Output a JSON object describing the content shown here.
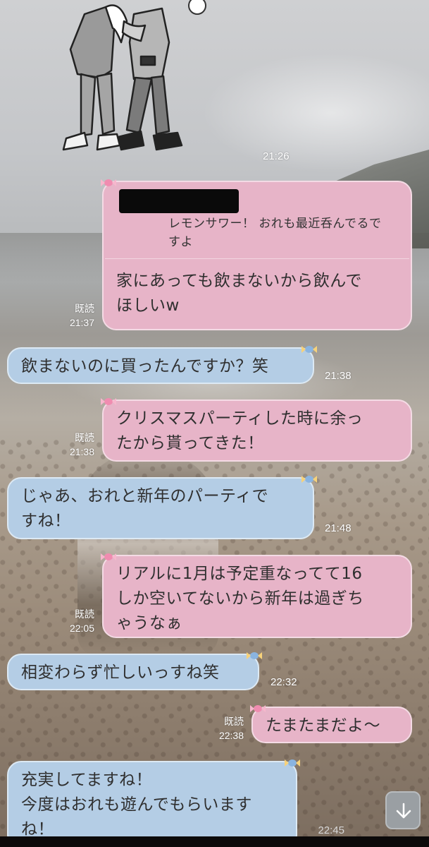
{
  "messages": [
    {
      "side": "out",
      "type": "reply",
      "quote": "レモンサワー！ おれも最近呑んでるですよ",
      "text": "家にあっても飲まないから飲んでほしいw",
      "read": "既読",
      "time": "21:37"
    },
    {
      "side": "in",
      "text": "飲まないのに買ったんですか？笑",
      "time": "21:38"
    },
    {
      "side": "out",
      "text": "クリスマスパーティした時に余ったから貰ってきた！",
      "read": "既読",
      "time": "21:38"
    },
    {
      "side": "in",
      "text": "じゃあ、おれと新年のパーティですね！",
      "time": "21:48"
    },
    {
      "side": "out",
      "text": "リアルに1月は予定重なってて16しか空いてないから新年は過ぎちゃうなぁ",
      "read": "既読",
      "time": "22:05"
    },
    {
      "side": "in",
      "text": "相変わらず忙しいっすね笑",
      "time": "22:32"
    },
    {
      "side": "out",
      "text": "たまたまだよ〜",
      "read": "既読",
      "time": "22:38"
    },
    {
      "side": "in",
      "text": "充実してますね！今度はおれも遊んでもらいますね！",
      "time": "22:45"
    }
  ],
  "sticker": {
    "name": "sticker-illustration",
    "time": "21:26"
  },
  "lines": {
    "m1_quote_1": "レモンサワー！ おれも最近呑んでるで",
    "m1_quote_2": "すよ",
    "m1_text_1": "家にあっても飲まないから飲んで",
    "m1_text_2": "ほしいw",
    "m2_text_1": "飲まないのに買ったんですか？笑",
    "m3_text_1": "クリスマスパーティした時に余っ",
    "m3_text_2": "たから貰ってきた！",
    "m4_text_1": "じゃあ、おれと新年のパーティで",
    "m4_text_2": "すね！",
    "m5_text_1": "リアルに1月は予定重なってて16",
    "m5_text_2": "しか空いてないから新年は過ぎち",
    "m5_text_3": "ゃうなぁ",
    "m6_text_1": "相変わらず忙しいっすね笑",
    "m7_text_1": "たまたまだよ〜",
    "m8_text_1": "充実してますね！",
    "m8_text_2": "今度はおれも遊んでもらいます",
    "m8_text_3": "ね！"
  },
  "read_label": "既読",
  "scroll_button": {
    "icon": "arrow-down-icon"
  },
  "colors": {
    "outgoing_bubble": "#e7b4c8",
    "incoming_bubble": "#b4cde5",
    "time_text": "#ffffff"
  }
}
